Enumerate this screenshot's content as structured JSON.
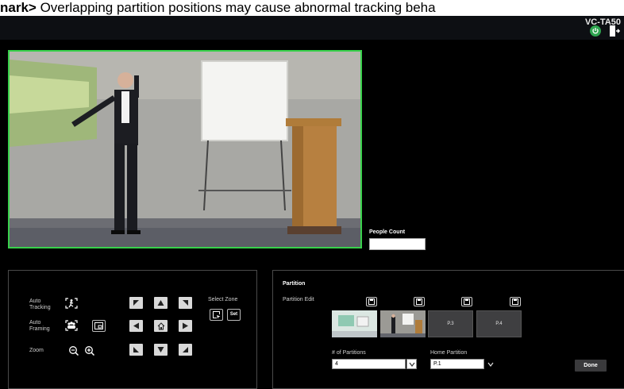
{
  "remark": {
    "prefix": "nark>",
    "text": " Overlapping partition positions may cause abnormal tracking beha"
  },
  "header": {
    "model": "VC-TA50",
    "icons": [
      "power-icon",
      "logout-icon"
    ],
    "power_color": "#2ea44f"
  },
  "video": {
    "border_color": "#38d14b",
    "people_count_label": "People Count",
    "people_count_value": ""
  },
  "controls": {
    "auto_tracking_label_1": "Auto",
    "auto_tracking_label_2": "Tracking",
    "auto_framing_label_1": "Auto",
    "auto_framing_label_2": "Framing",
    "zoom_label": "Zoom",
    "select_zone_label": "Select Zone",
    "set_label": "Set"
  },
  "partition": {
    "title": "Partition",
    "edit_label": "Partition Edit",
    "thumbs": [
      "",
      "",
      "P.3",
      "P.4"
    ],
    "num_partitions_label": "# of Partitions",
    "num_partitions_value": "4",
    "home_partition_label": "Home Partition",
    "home_partition_value": "P.1",
    "done_label": "Done"
  }
}
